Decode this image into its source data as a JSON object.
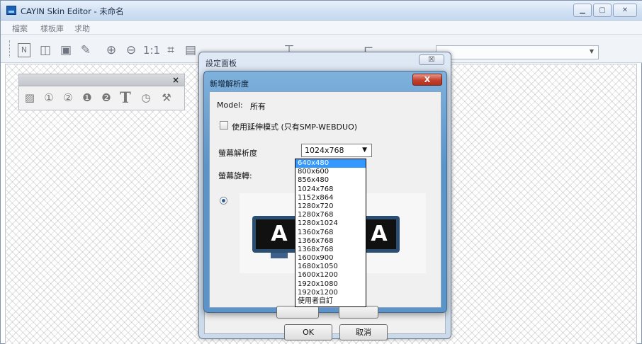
{
  "app": {
    "title": "CAYIN Skin Editor - 未命名",
    "window_buttons": [
      "minimize",
      "maximize",
      "close"
    ]
  },
  "menu": {
    "items": [
      "檔案",
      "樣板庫",
      "求助"
    ]
  },
  "toolbar": {
    "icons": [
      "new-document-icon",
      "open-folder-icon",
      "save-icon",
      "pencil-icon",
      "zoom-in-icon",
      "zoom-out-icon",
      "actual-size-icon",
      "fit-window-icon",
      "layout-icon",
      "layout-icon",
      "layout-icon",
      "layout-icon",
      "align-icon",
      "arrange-icon"
    ],
    "zoom_label": "1:1",
    "combo_value": ""
  },
  "palette": {
    "close_label": "×",
    "icons": [
      "image-tool-icon",
      "video-zone-1-icon",
      "video-zone-2-icon",
      "zone-1-icon",
      "zone-2-icon",
      "text-tool-icon",
      "clock-tool-icon",
      "wrench-tool-icon"
    ]
  },
  "settings_panel": {
    "title": "設定面板",
    "close_label": "☒",
    "ok_label": "OK",
    "cancel_label": "取消"
  },
  "dialog": {
    "title": "新增解析度",
    "close_label": "X",
    "model_label": "Model:",
    "model_value": "所有",
    "extended_mode_label": "使用延伸模式 (只有SMP-WEBDUO)",
    "extended_mode_checked": false,
    "resolution_label": "螢幕解析度",
    "resolution_value": "1024x768",
    "rotation_label": "螢幕旋轉:",
    "monitor_letter": "A"
  },
  "resolution_dropdown": {
    "options": [
      "640x480",
      "800x600",
      "856x480",
      "1024x768",
      "1152x864",
      "1280x720",
      "1280x768",
      "1280x1024",
      "1360x768",
      "1366x768",
      "1368x768",
      "1600x900",
      "1680x1050",
      "1600x1200",
      "1920x1080",
      "1920x1200",
      "使用者自訂"
    ],
    "highlighted": "640x480"
  },
  "colors": {
    "dialog_frame": "#5a94c8",
    "selection": "#3399ff",
    "monitor_frame": "#2b4e73",
    "close_button": "#c2412d"
  }
}
